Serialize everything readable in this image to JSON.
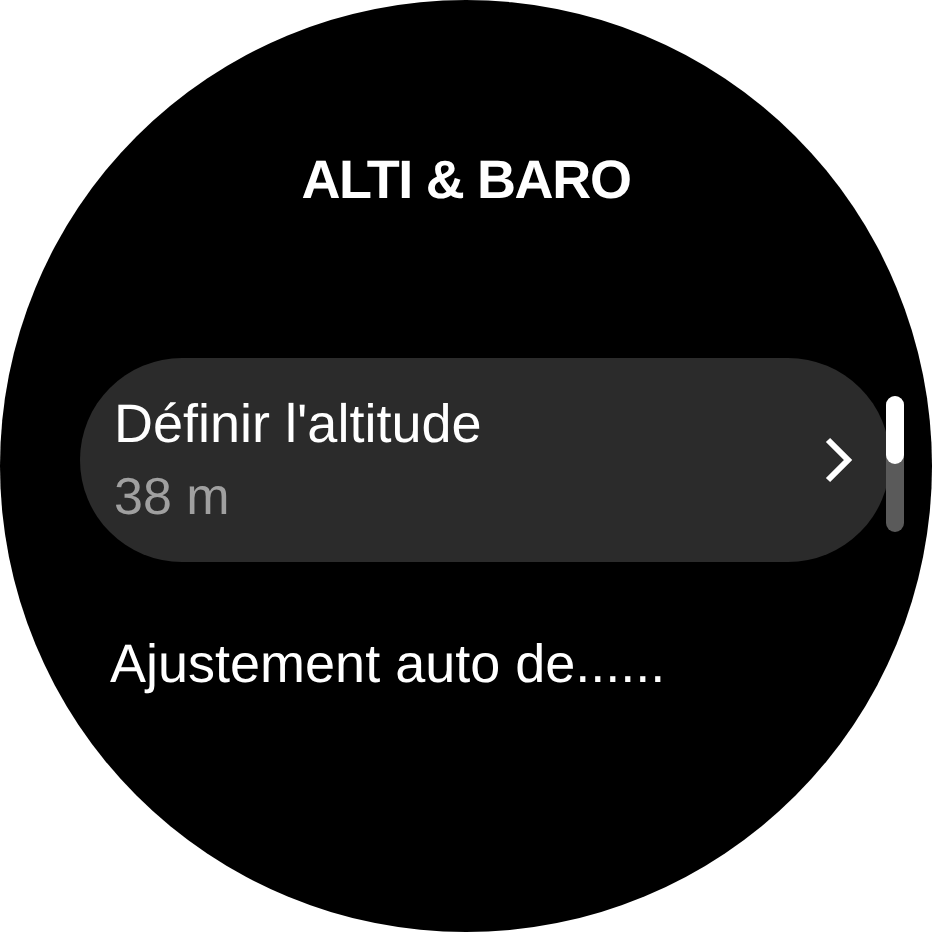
{
  "title": "ALTI & BARO",
  "items": [
    {
      "kind": "setting",
      "label": "Définir l'altitude",
      "value": "38 m",
      "selected": true
    },
    {
      "kind": "plain",
      "label": "Ajustement auto de......",
      "selected": false
    }
  ]
}
